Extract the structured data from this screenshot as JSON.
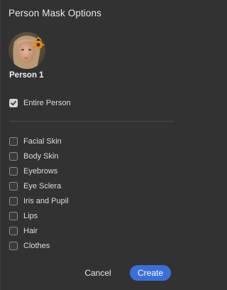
{
  "dialog": {
    "title": "Person Mask Options"
  },
  "person": {
    "name": "Person 1"
  },
  "entire_person": {
    "label": "Entire Person",
    "checked": true
  },
  "options": [
    {
      "label": "Facial Skin",
      "checked": false
    },
    {
      "label": "Body Skin",
      "checked": false
    },
    {
      "label": "Eyebrows",
      "checked": false
    },
    {
      "label": "Eye Sclera",
      "checked": false
    },
    {
      "label": "Iris and Pupil",
      "checked": false
    },
    {
      "label": "Lips",
      "checked": false
    },
    {
      "label": "Hair",
      "checked": false
    },
    {
      "label": "Clothes",
      "checked": false
    }
  ],
  "buttons": {
    "cancel": "Cancel",
    "create": "Create"
  },
  "colors": {
    "background": "#323232",
    "accent": "#3b6fd8"
  }
}
